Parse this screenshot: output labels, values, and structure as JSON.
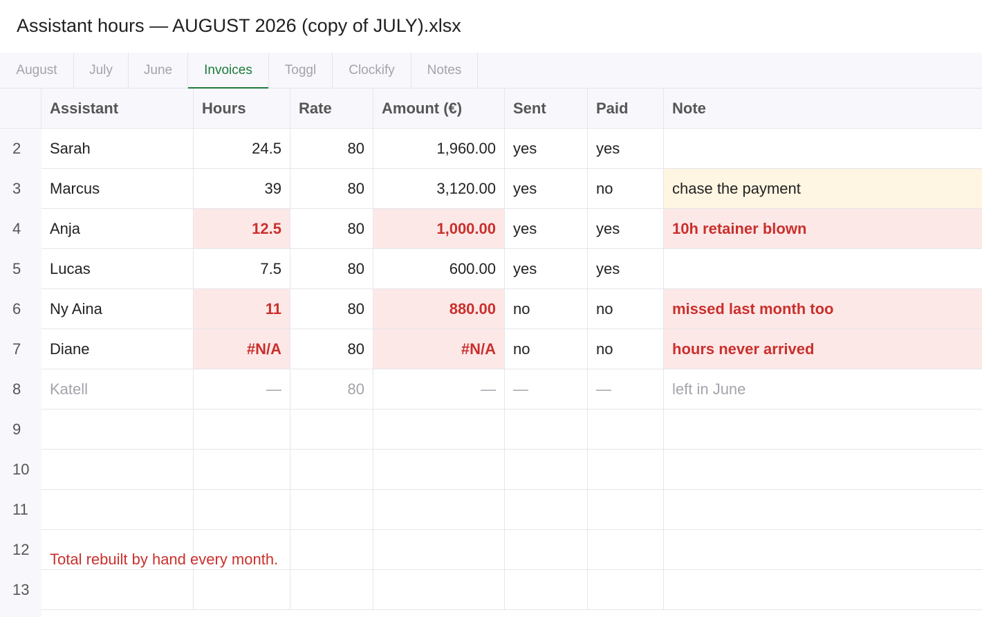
{
  "window": {
    "title": "Assistant hours — AUGUST 2026 (copy of JULY).xlsx"
  },
  "tabs": [
    {
      "label": "August"
    },
    {
      "label": "July"
    },
    {
      "label": "June"
    },
    {
      "label": "Invoices",
      "active": true
    },
    {
      "label": "Toggl"
    },
    {
      "label": "Clockify"
    },
    {
      "label": "Notes"
    }
  ],
  "sheet": {
    "headers": [
      "Assistant",
      "Hours",
      "Rate",
      "Amount (€)",
      "Sent",
      "Paid",
      "Note"
    ],
    "row_numbers": [
      "2",
      "3",
      "4",
      "5",
      "6",
      "7",
      "8",
      "9",
      "10",
      "11",
      "12",
      "13"
    ],
    "rows": [
      {
        "assistant": "Sarah",
        "hours": "24.5",
        "rate": "80",
        "amount": "1,960.00",
        "sent": "yes",
        "paid": "yes",
        "note": ""
      },
      {
        "assistant": "Marcus",
        "hours": "39",
        "rate": "80",
        "amount": "3,120.00",
        "sent": "yes",
        "paid": "no",
        "note": "chase the payment"
      },
      {
        "assistant": "Anja",
        "hours": "12.5",
        "rate": "80",
        "amount": "1,000.00",
        "sent": "yes",
        "paid": "yes",
        "note": "10h retainer blown"
      },
      {
        "assistant": "Lucas",
        "hours": "7.5",
        "rate": "80",
        "amount": "600.00",
        "sent": "yes",
        "paid": "yes",
        "note": ""
      },
      {
        "assistant": "Ny Aina",
        "hours": "11",
        "rate": "80",
        "amount": "880.00",
        "sent": "no",
        "paid": "no",
        "note": "missed last month too"
      },
      {
        "assistant": "Diane",
        "hours": "#N/A",
        "rate": "80",
        "amount": "#N/A",
        "sent": "no",
        "paid": "no",
        "note": "hours never arrived"
      },
      {
        "assistant": "Katell",
        "hours": "—",
        "rate": "80",
        "amount": "—",
        "sent": "—",
        "paid": "—",
        "note": "left in June"
      }
    ],
    "footnote": "Total rebuilt by hand every month."
  },
  "colors": {
    "accent": "#1e7a3a",
    "error_text": "#c9302c",
    "error_fill": "#fde8e8",
    "warn_fill": "#fef5e2",
    "muted": "#a3a3ab"
  }
}
